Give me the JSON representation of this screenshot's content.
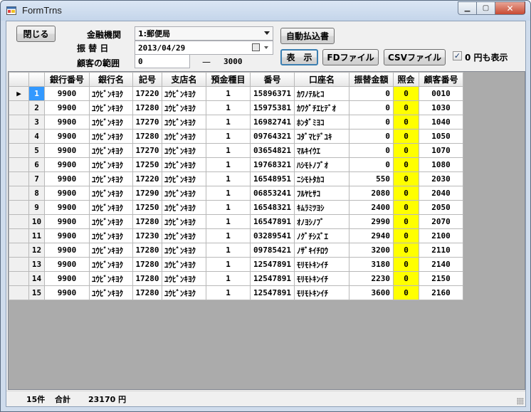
{
  "window": {
    "title": "FormTrns"
  },
  "controls": {
    "close_label": "閉じる",
    "bank_label": "金融機関",
    "bank_value": "1:郵便局",
    "date_label": "振 替 日",
    "date_value": "2013/04/29",
    "range_label": "顧客の範囲",
    "range_from": "0",
    "range_sep": "—",
    "range_to": "3000",
    "auto_label": "自動払込書",
    "show_label": "表　示",
    "fd_label": "FDファイル",
    "csv_label": "CSVファイル",
    "zero_checked": true,
    "zero_label": "0 円も表示"
  },
  "grid": {
    "columns": [
      "",
      "",
      "銀行番号",
      "銀行名",
      "記号",
      "支店名",
      "預金種目",
      "番号",
      "口座名",
      "振替金額",
      "照会",
      "顧客番号"
    ],
    "rows": [
      [
        "▶",
        "1",
        "9900",
        "ﾕｳﾋﾞﾝｷﾖｸ",
        "17220",
        "ﾕｳﾋﾞﾝｷﾖｸ",
        "1",
        "15896371",
        "ｶﾜﾉﾃﾙﾋｺ",
        "0",
        "0",
        "0010"
      ],
      [
        "",
        "2",
        "9900",
        "ﾕｳﾋﾞﾝｷﾖｸ",
        "17280",
        "ﾕｳﾋﾞﾝｷﾖｸ",
        "1",
        "15975381",
        "ｶﾜｸﾞﾁｴﾋﾃﾞｵ",
        "0",
        "0",
        "1030"
      ],
      [
        "",
        "3",
        "9900",
        "ﾕｳﾋﾞﾝｷﾖｸ",
        "17270",
        "ﾕｳﾋﾞﾝｷﾖｸ",
        "1",
        "16982741",
        "ﾎﾝﾀﾞﾐﾖｺ",
        "0",
        "0",
        "1040"
      ],
      [
        "",
        "4",
        "9900",
        "ﾕｳﾋﾞﾝｷﾖｸ",
        "17280",
        "ﾕｳﾋﾞﾝｷﾖｸ",
        "1",
        "09764321",
        "ｺﾀﾞﾏﾋﾃﾞﾕｷ",
        "0",
        "0",
        "1050"
      ],
      [
        "",
        "5",
        "9900",
        "ﾕｳﾋﾞﾝｷﾖｸ",
        "17270",
        "ﾕｳﾋﾞﾝｷﾖｸ",
        "1",
        "03654821",
        "ﾏﾙｷｲｳｴ",
        "0",
        "0",
        "1070"
      ],
      [
        "",
        "6",
        "9900",
        "ﾕｳﾋﾞﾝｷﾖｸ",
        "17250",
        "ﾕｳﾋﾞﾝｷﾖｸ",
        "1",
        "19768321",
        "ﾊｼﾓﾄﾉﾌﾞｵ",
        "0",
        "0",
        "1080"
      ],
      [
        "",
        "7",
        "9900",
        "ﾕｳﾋﾞﾝｷﾖｸ",
        "17220",
        "ﾕｳﾋﾞﾝｷﾖｸ",
        "1",
        "16548951",
        "ﾆｼﾓﾄﾀｶｺ",
        "550",
        "0",
        "2030"
      ],
      [
        "",
        "8",
        "9900",
        "ﾕｳﾋﾞﾝｷﾖｸ",
        "17290",
        "ﾕｳﾋﾞﾝｷﾖｸ",
        "1",
        "06853241",
        "ﾌﾙﾔﾋｻｺ",
        "2080",
        "0",
        "2040"
      ],
      [
        "",
        "9",
        "9900",
        "ﾕｳﾋﾞﾝｷﾖｸ",
        "17250",
        "ﾕｳﾋﾞﾝｷﾖｸ",
        "1",
        "16548321",
        "ｷﾑﾗﾐﾂﾖｼ",
        "2400",
        "0",
        "2050"
      ],
      [
        "",
        "10",
        "9900",
        "ﾕｳﾋﾞﾝｷﾖｸ",
        "17280",
        "ﾕｳﾋﾞﾝｷﾖｸ",
        "1",
        "16547891",
        "ｵﾉﾖｼﾉﾌﾞ",
        "2990",
        "0",
        "2070"
      ],
      [
        "",
        "11",
        "9900",
        "ﾕｳﾋﾞﾝｷﾖｸ",
        "17230",
        "ﾕｳﾋﾞﾝｷﾖｸ",
        "1",
        "03289541",
        "ﾉｸﾞﾁｼｽﾞｴ",
        "2940",
        "0",
        "2100"
      ],
      [
        "",
        "12",
        "9900",
        "ﾕｳﾋﾞﾝｷﾖｸ",
        "17280",
        "ﾕｳﾋﾞﾝｷﾖｸ",
        "1",
        "09785421",
        "ﾉｻﾞｷｲﾁﾛｳ",
        "3200",
        "0",
        "2110"
      ],
      [
        "",
        "13",
        "9900",
        "ﾕｳﾋﾞﾝｷﾖｸ",
        "17280",
        "ﾕｳﾋﾞﾝｷﾖｸ",
        "1",
        "12547891",
        "ﾓﾘﾓﾄｷﾝｲﾁ",
        "3180",
        "0",
        "2140"
      ],
      [
        "",
        "14",
        "9900",
        "ﾕｳﾋﾞﾝｷﾖｸ",
        "17280",
        "ﾕｳﾋﾞﾝｷﾖｸ",
        "1",
        "12547891",
        "ﾓﾘﾓﾄｷﾝｲﾁ",
        "2230",
        "0",
        "2150"
      ],
      [
        "",
        "15",
        "9900",
        "ﾕｳﾋﾞﾝｷﾖｸ",
        "17280",
        "ﾕｳﾋﾞﾝｷﾖｸ",
        "1",
        "12547891",
        "ﾓﾘﾓﾄｷﾝｲﾁ",
        "3600",
        "0",
        "2160"
      ]
    ]
  },
  "status": {
    "count": "15件",
    "total_label": "合計",
    "total_value": "23170 円"
  },
  "colors": {
    "selected_row_header": "#3399ff",
    "inquiry_highlight": "#ffff00",
    "grid_background": "#ababab"
  },
  "icons": {
    "app": "form-app-icon",
    "minimize": "minimize-icon",
    "maximize": "maximize-icon",
    "close": "close-icon"
  }
}
